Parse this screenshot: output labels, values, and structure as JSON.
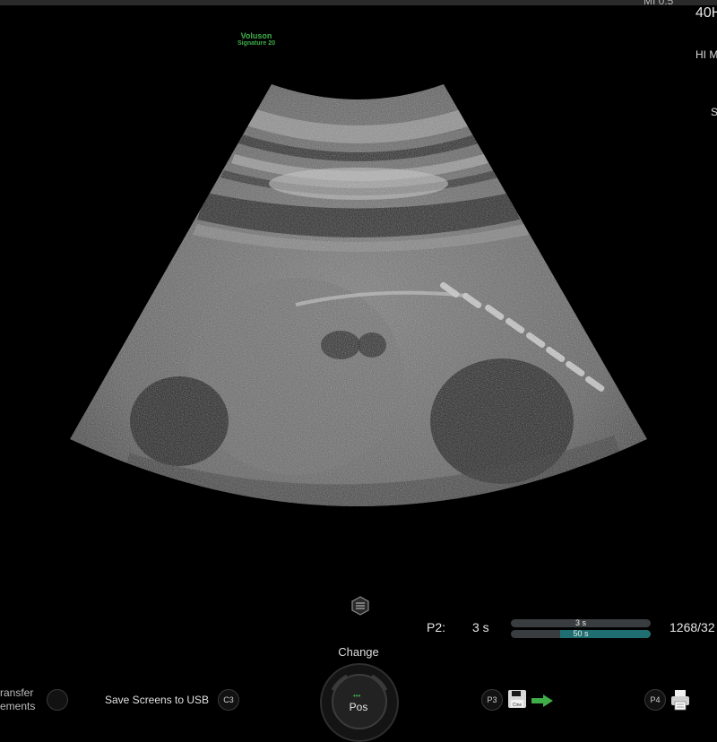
{
  "header": {
    "top_truncated": "MI 0.5",
    "brand_line1": "Voluson",
    "brand_line2": "Signature 20",
    "frequency": "40H",
    "mode": "HI M",
    "side_label": "S"
  },
  "cine": {
    "param_label": "P2:",
    "param_value": "3 s",
    "bar_top_label": "3 s",
    "bar_bottom_label": "50 s",
    "bar_bottom_fill": 0.65,
    "frame_counter": "1268/32",
    "bar_fill_color": "#1f6f72"
  },
  "controls": {
    "change_label": "Change",
    "knob_label": "Pos",
    "knob_indicator": "•••",
    "transfer_line1": "ransfer",
    "transfer_line2": "ements",
    "c3_label": "C3",
    "save_usb_label": "Save Screens to USB",
    "p3_label": "P3",
    "cine_icon_text": "Cine",
    "p4_label": "P4"
  },
  "colors": {
    "accent_green": "#3fae49",
    "background": "#000000"
  },
  "icons": [
    "layers-icon",
    "cine-save-icon",
    "green-arrow-icon",
    "printer-icon"
  ]
}
